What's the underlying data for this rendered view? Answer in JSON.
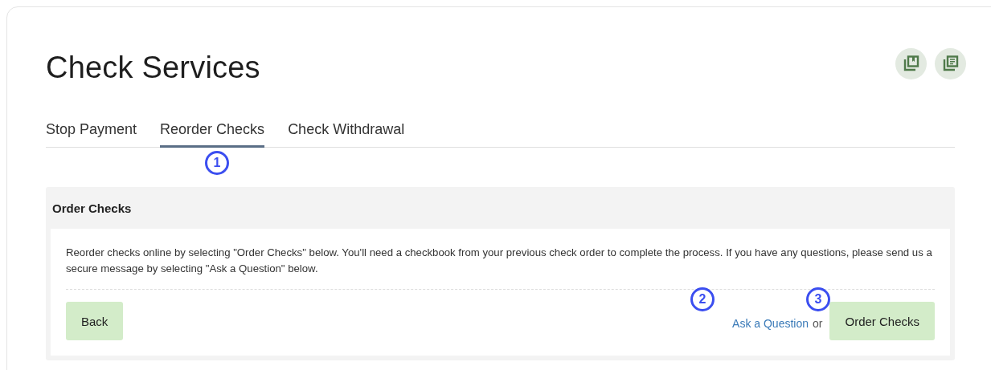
{
  "page": {
    "title": "Check Services"
  },
  "header_actions": [
    {
      "kind": "bookmark"
    },
    {
      "kind": "document"
    }
  ],
  "tabs": [
    {
      "label": "Stop Payment",
      "selected": false
    },
    {
      "label": "Reorder Checks",
      "selected": true
    },
    {
      "label": "Check Withdrawal",
      "selected": false
    }
  ],
  "panel": {
    "title": "Order Checks",
    "description": "Reorder checks online by selecting \"Order Checks\" below. You'll need a checkbook from your previous check order to complete the process. If you have any questions, please send us a secure message by selecting \"Ask a Question\" below.",
    "back_button": "Back",
    "link": "Ask a Question",
    "separator": "or",
    "primary_button": "Order Checks"
  },
  "callouts": [
    "1",
    "2",
    "3"
  ]
}
